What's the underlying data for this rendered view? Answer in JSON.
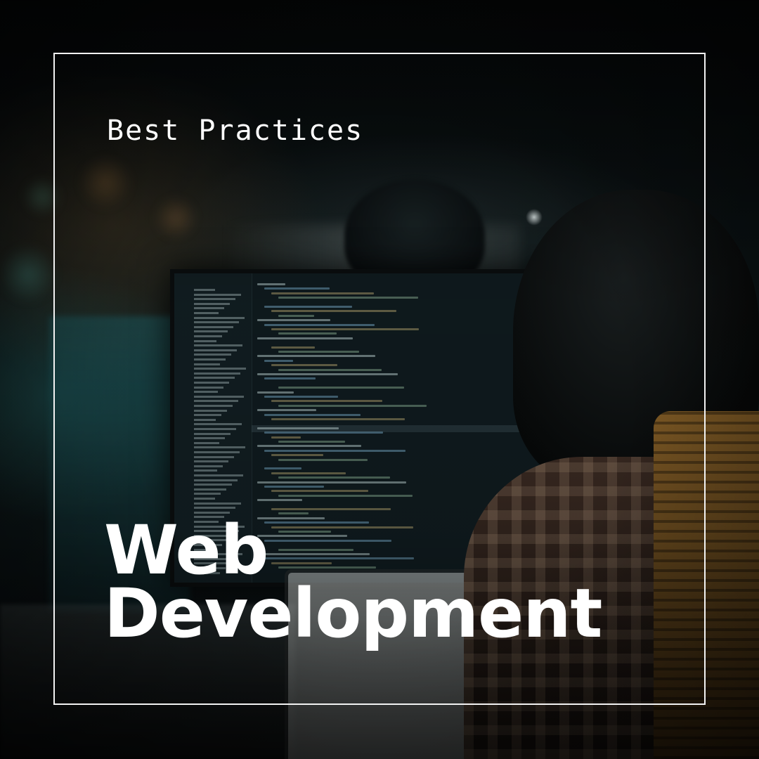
{
  "overlay": {
    "kicker": "Best Practices",
    "headline_line1": "Web",
    "headline_line2": "Development"
  },
  "colors": {
    "text": "#ffffff",
    "frame": "#f2f2f2",
    "background": "#05080a"
  }
}
